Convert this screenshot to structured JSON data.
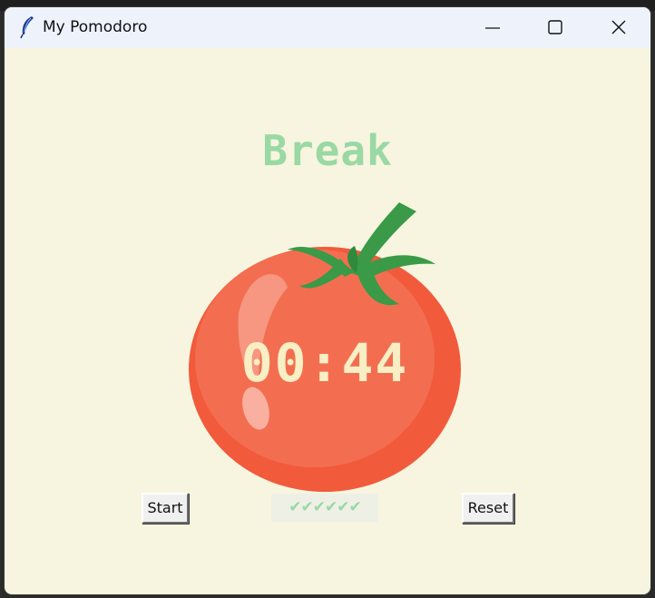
{
  "window": {
    "title": "My Pomodoro",
    "background": "#f7f5df"
  },
  "icons": {
    "app": "feather-icon",
    "minimize": "minimize-icon",
    "maximize": "maximize-icon",
    "close": "close-icon"
  },
  "main": {
    "state_label": "Break",
    "state_color": "#9ad8a4",
    "timer": "00:44",
    "checkmarks": "✔✔✔✔✔✔",
    "start_label": "Start",
    "reset_label": "Reset"
  },
  "colors": {
    "tomato": "#f26b4f",
    "leaves": "#3a9a47",
    "timer_text": "#f8efc4"
  }
}
